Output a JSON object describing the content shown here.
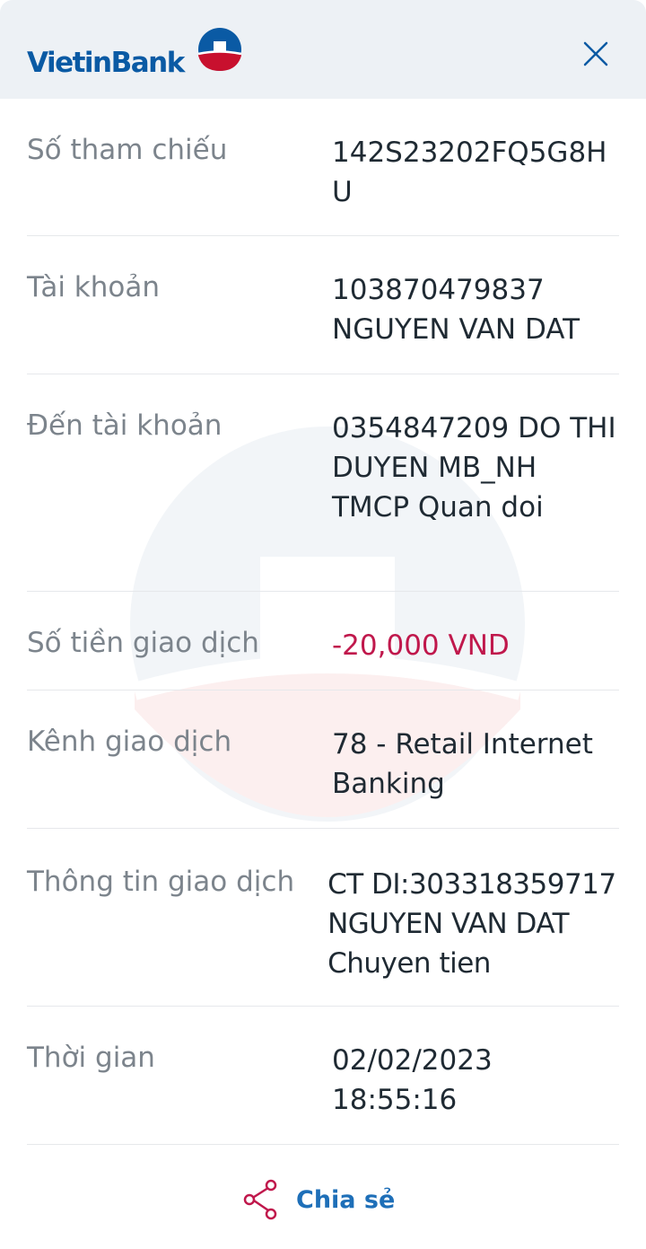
{
  "header": {
    "logo_text": "VietinBank",
    "logo_colors": {
      "blue": "#0a5aa4",
      "red": "#c8102e"
    }
  },
  "rows": [
    {
      "label": "Số tham chiếu",
      "value": "142S23202FQ5G8HU"
    },
    {
      "label": "Tài khoản",
      "value": "103870479837 NGUYEN VAN DAT"
    },
    {
      "label": "Đến tài khoản",
      "value": "0354847209 DO THI DUYEN MB_NH TMCP Quan doi"
    },
    {
      "label": "Số tiền giao dịch",
      "value": "-20,000 VND"
    },
    {
      "label": "Kênh giao dịch",
      "value": "78 - Retail Internet Banking"
    },
    {
      "label": "Thông tin giao dịch",
      "value": "CT DI:303318359717 NGUYEN VAN DAT Chuyen tien"
    },
    {
      "label": "Thời gian",
      "value": "02/02/2023 18:55:16"
    }
  ],
  "share": {
    "label": "Chia sẻ",
    "icon": "share-icon"
  },
  "colors": {
    "amount": "#c0184c",
    "share": "#1e6fb8",
    "label": "#7c848c",
    "value": "#1f2a33"
  }
}
